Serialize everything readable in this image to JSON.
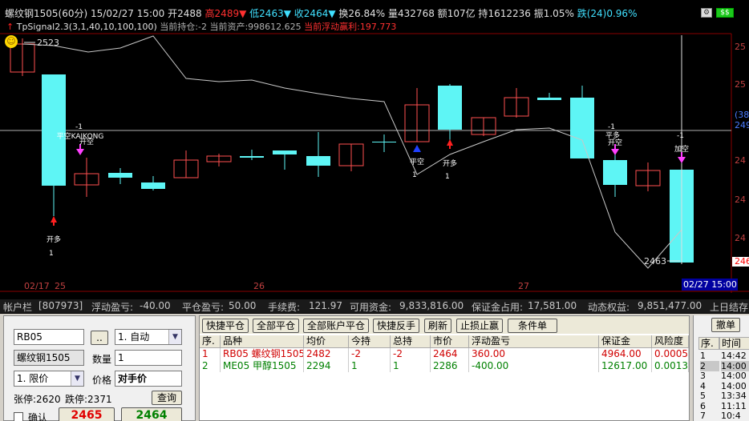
{
  "header": {
    "symbol": "螺纹钢1505",
    "period": "(60分)",
    "datetime": "15/02/27 15:00",
    "open_label": "开",
    "open": "2488",
    "high_label": "高",
    "high": "2489",
    "low_label": "低",
    "low": "2463",
    "close_label": "收",
    "close": "2464",
    "turnover_label": "换",
    "turnover": "26.84%",
    "volume_label": "量",
    "volume": "432768",
    "amount_label": "额",
    "amount": "107亿",
    "oi_label": "持",
    "oi": "1612236",
    "amp_label": "振",
    "amp": "1.05%",
    "change_label": "跌",
    "change": "(24)",
    "change_pct": "0.96%"
  },
  "signal_line": {
    "name": "TpSignal2.3(3,1,40,10,100,100)",
    "position_label": "当前持仓:",
    "position": "-2",
    "assets_label": "当前资产:",
    "assets": "998612.625",
    "float_label": "当前浮动赢利:",
    "float_pl": "197.773"
  },
  "chart": {
    "price_high_label": "2523",
    "price_low_label": "2463",
    "right_axis": [
      "25",
      "25",
      "(384",
      "249",
      "24",
      "24",
      "24",
      "246"
    ],
    "x_labels": [
      "02/17",
      "25",
      "26",
      "27"
    ],
    "cursor_time": "02/27 15:00",
    "signals": [
      {
        "text": "开多",
        "sub": "1"
      },
      {
        "text": "平空KAIKONG",
        "sub": "-1"
      },
      {
        "text": "开空",
        "sub": ""
      },
      {
        "text": "平空",
        "sub": "1"
      },
      {
        "text": "开多",
        "sub": "1"
      },
      {
        "text": "平多",
        "sub": "-1"
      },
      {
        "text": "开空",
        "sub": ""
      },
      {
        "text": "平多",
        "sub": "-1"
      },
      {
        "text": "开空",
        "sub": ""
      },
      {
        "text": "加空",
        "sub": "-1"
      }
    ],
    "colors": {
      "up": "#ff5050",
      "down": "#5ef5f5",
      "line": "#c8c8c8"
    }
  },
  "account_bar": {
    "title": "帐户栏",
    "account": "[807973]",
    "float_label": "浮动盈亏:",
    "float": "-40.00",
    "close_label": "平仓盈亏:",
    "close": "50.00",
    "fee_label": "手续费:",
    "fee": "121.97",
    "avail_label": "可用资金:",
    "avail": "9,833,816.00",
    "margin_label": "保证金占用:",
    "margin": "17,581.00",
    "equity_label": "动态权益:",
    "equity": "9,851,477.00",
    "prev_label": "上日结存"
  },
  "order": {
    "code": "RB05",
    "browse_btn": "..",
    "mode": "1. 自动",
    "name": "螺纹钢1505",
    "qty_label": "数量",
    "qty": "1",
    "price_type": "1. 限价",
    "price_label": "价格",
    "price": "对手价",
    "limit_up": "张停:2620",
    "limit_down": "跌停:2371",
    "query_btn": "查询",
    "confirm_label": "确认",
    "buy_price": "2465",
    "sell_price": "2464"
  },
  "positions": {
    "toolbar": [
      "快捷平仓",
      "全部平仓",
      "全部账户平仓",
      "快捷反手",
      "刷新",
      "止损止赢",
      "条件单"
    ],
    "columns": [
      "序.",
      "品种",
      "均价",
      "今持",
      "总持",
      "市价",
      "浮动盈亏",
      "保证金",
      "风险度"
    ],
    "rows": [
      [
        "1",
        "RB05  螺纹钢1505",
        "2482",
        "-2",
        "-2",
        "2464",
        "360.00",
        "4964.00",
        "0.0005"
      ],
      [
        "2",
        "ME05  甲醇1505",
        "2294",
        "1",
        "1",
        "2286",
        "-400.00",
        "12617.00",
        "0.0013"
      ]
    ]
  },
  "trades": {
    "cancel_btn": "撤单",
    "columns": [
      "序.",
      "时间"
    ],
    "rows": [
      [
        "1",
        "14:42"
      ],
      [
        "2",
        "14:00"
      ],
      [
        "3",
        "14:00"
      ],
      [
        "4",
        "14:00"
      ],
      [
        "5",
        "13:34"
      ],
      [
        "6",
        "11:11"
      ],
      [
        "7",
        "10:4"
      ]
    ]
  }
}
